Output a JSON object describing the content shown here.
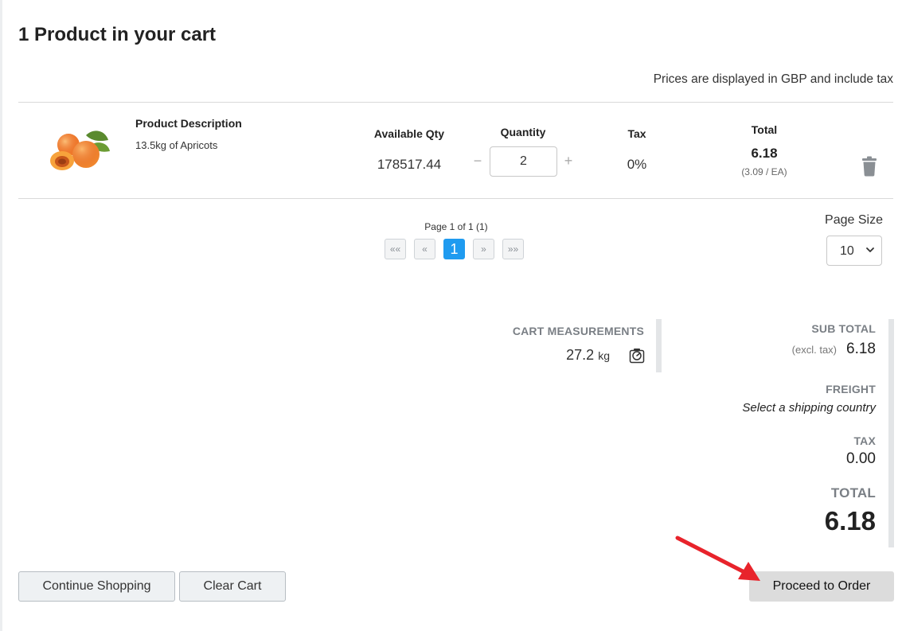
{
  "page": {
    "title": "1 Product in your cart",
    "prices_note": "Prices are displayed in GBP and include tax"
  },
  "product": {
    "image": "apricots-image",
    "description_heading": "Product Description",
    "description": "13.5kg of Apricots",
    "available_qty_label": "Available Qty",
    "available_qty": "178517.44",
    "quantity_label": "Quantity",
    "quantity": "2",
    "minus": "−",
    "plus": "+",
    "tax_label": "Tax",
    "tax": "0%",
    "total_label": "Total",
    "total": "6.18",
    "unit_price": "(3.09 / EA)",
    "delete_icon": "trash-icon"
  },
  "pagination": {
    "page_info": "Page 1 of 1 (1)",
    "first": "««",
    "prev": "«",
    "current": "1",
    "next": "»",
    "last": "»»",
    "page_size_label": "Page Size",
    "page_size": "10"
  },
  "measurements": {
    "title": "CART MEASUREMENTS",
    "value": "27.2",
    "unit": "kg",
    "icon": "scale-icon"
  },
  "summary": {
    "subtotal_label": "SUB TOTAL",
    "excl_tax": "(excl. tax)",
    "subtotal": "6.18",
    "freight_label": "FREIGHT",
    "freight_value": "Select a shipping country",
    "tax_label": "TAX",
    "tax": "0.00",
    "total_label": "TOTAL",
    "total": "6.18"
  },
  "actions": {
    "continue_shopping": "Continue Shopping",
    "clear_cart": "Clear Cart",
    "proceed": "Proceed to Order"
  },
  "colors": {
    "accent": "#1f9bf0",
    "annotation_arrow": "#e8232b"
  }
}
